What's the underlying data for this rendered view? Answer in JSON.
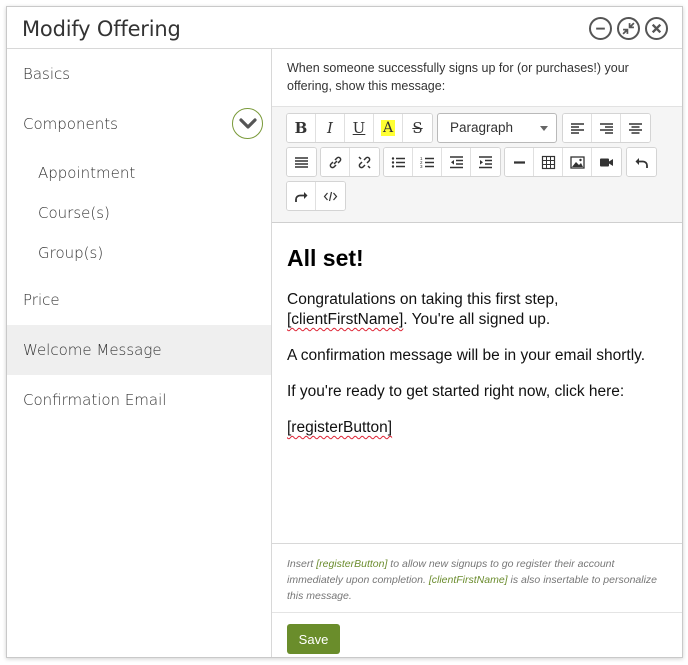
{
  "dialog": {
    "title": "Modify Offering",
    "window_buttons": [
      "minimize-icon",
      "shrink-icon",
      "close-icon"
    ]
  },
  "sidebar": {
    "items": [
      {
        "label": "Basics"
      },
      {
        "label": "Components"
      },
      {
        "label": "Appointment"
      },
      {
        "label": "Course(s)"
      },
      {
        "label": "Group(s)"
      },
      {
        "label": "Price"
      },
      {
        "label": "Welcome Message",
        "active": true
      },
      {
        "label": "Confirmation Email"
      }
    ]
  },
  "main": {
    "intro": "When someone successfully signs up for (or purchases!) your offering, show this message:",
    "toolbar": {
      "format_select": "Paragraph",
      "bold": "B",
      "italic": "I",
      "underline": "U",
      "highlight": "A",
      "strike": "S"
    },
    "content": {
      "heading": "All set!",
      "p1_before": "Congratulations on taking this first step, ",
      "p1_tag": "[clientFirstName]",
      "p1_after": ". You're all signed up.",
      "p2": "A confirmation message will be in your email shortly.",
      "p3": "If you're ready to get started right now, click here:",
      "p4_tag": "[registerButton]"
    },
    "hint": {
      "t1": "Insert ",
      "tag1": "[registerButton]",
      "t2": " to allow new signups to go register their account immediately upon completion. ",
      "tag2": "[clientFirstName]",
      "t3": " is also insertable to personalize this message."
    },
    "save_label": "Save"
  },
  "colors": {
    "accent": "#6a8d2b",
    "active_bg": "#efefef"
  }
}
